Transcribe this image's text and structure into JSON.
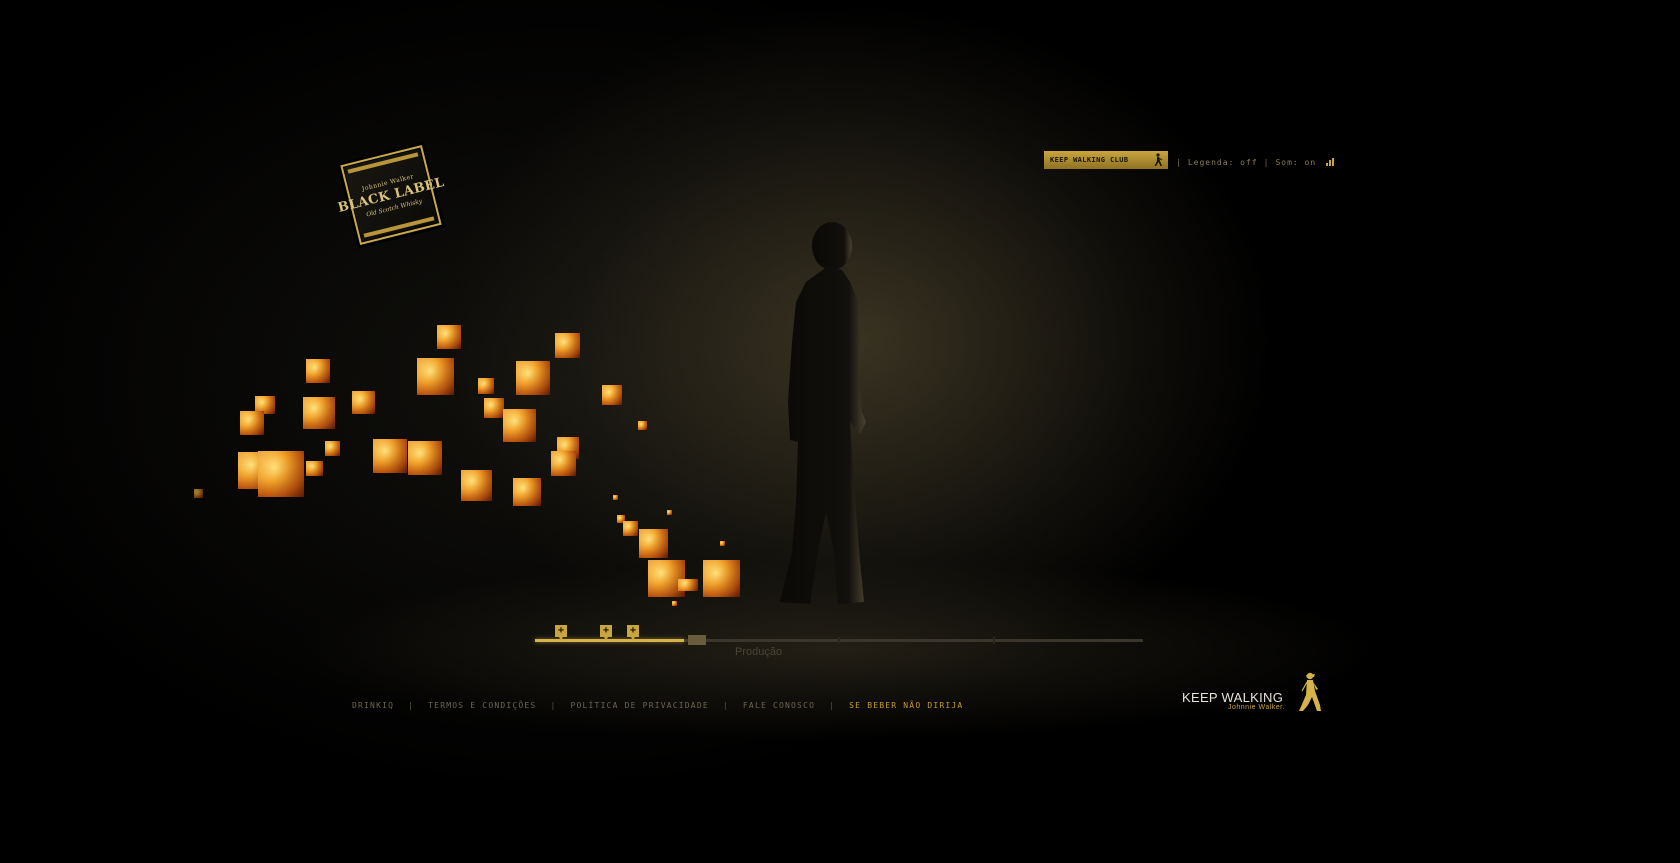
{
  "header": {
    "label_emblem": {
      "top_text": "Johnnie Walker",
      "main_text": "BLACK LABEL",
      "sub_text": "Old Scotch Whisky"
    },
    "keep_walking_club_label": "Keep Walking Club",
    "legenda_label": "Legenda: off",
    "som_label": "Som: on",
    "separator": "|"
  },
  "timeline": {
    "section_label": "Produção",
    "progress": 0.245,
    "marker_symbol": "+"
  },
  "footer": {
    "links": [
      {
        "label": "Drinkiq"
      },
      {
        "label": "Termos e Condições"
      },
      {
        "label": "Política de Privacidade"
      },
      {
        "label": "Fale Conosco"
      },
      {
        "label": "Se beber não dirija"
      }
    ],
    "separator": "|"
  },
  "brand": {
    "main": "KEEP WALKING",
    "sub": "Johnnie Walker."
  },
  "colors": {
    "background": "#000000",
    "accent_gold": "#c9a53f",
    "footer_text": "#6d6552",
    "footer_accent": "#c49a30",
    "brand_text": "#e8e4d8"
  },
  "icons": {
    "striding_man": "striding-man-icon",
    "sound_bars": "sound-bars-icon",
    "timeline_marker": "plus-marker-icon"
  }
}
